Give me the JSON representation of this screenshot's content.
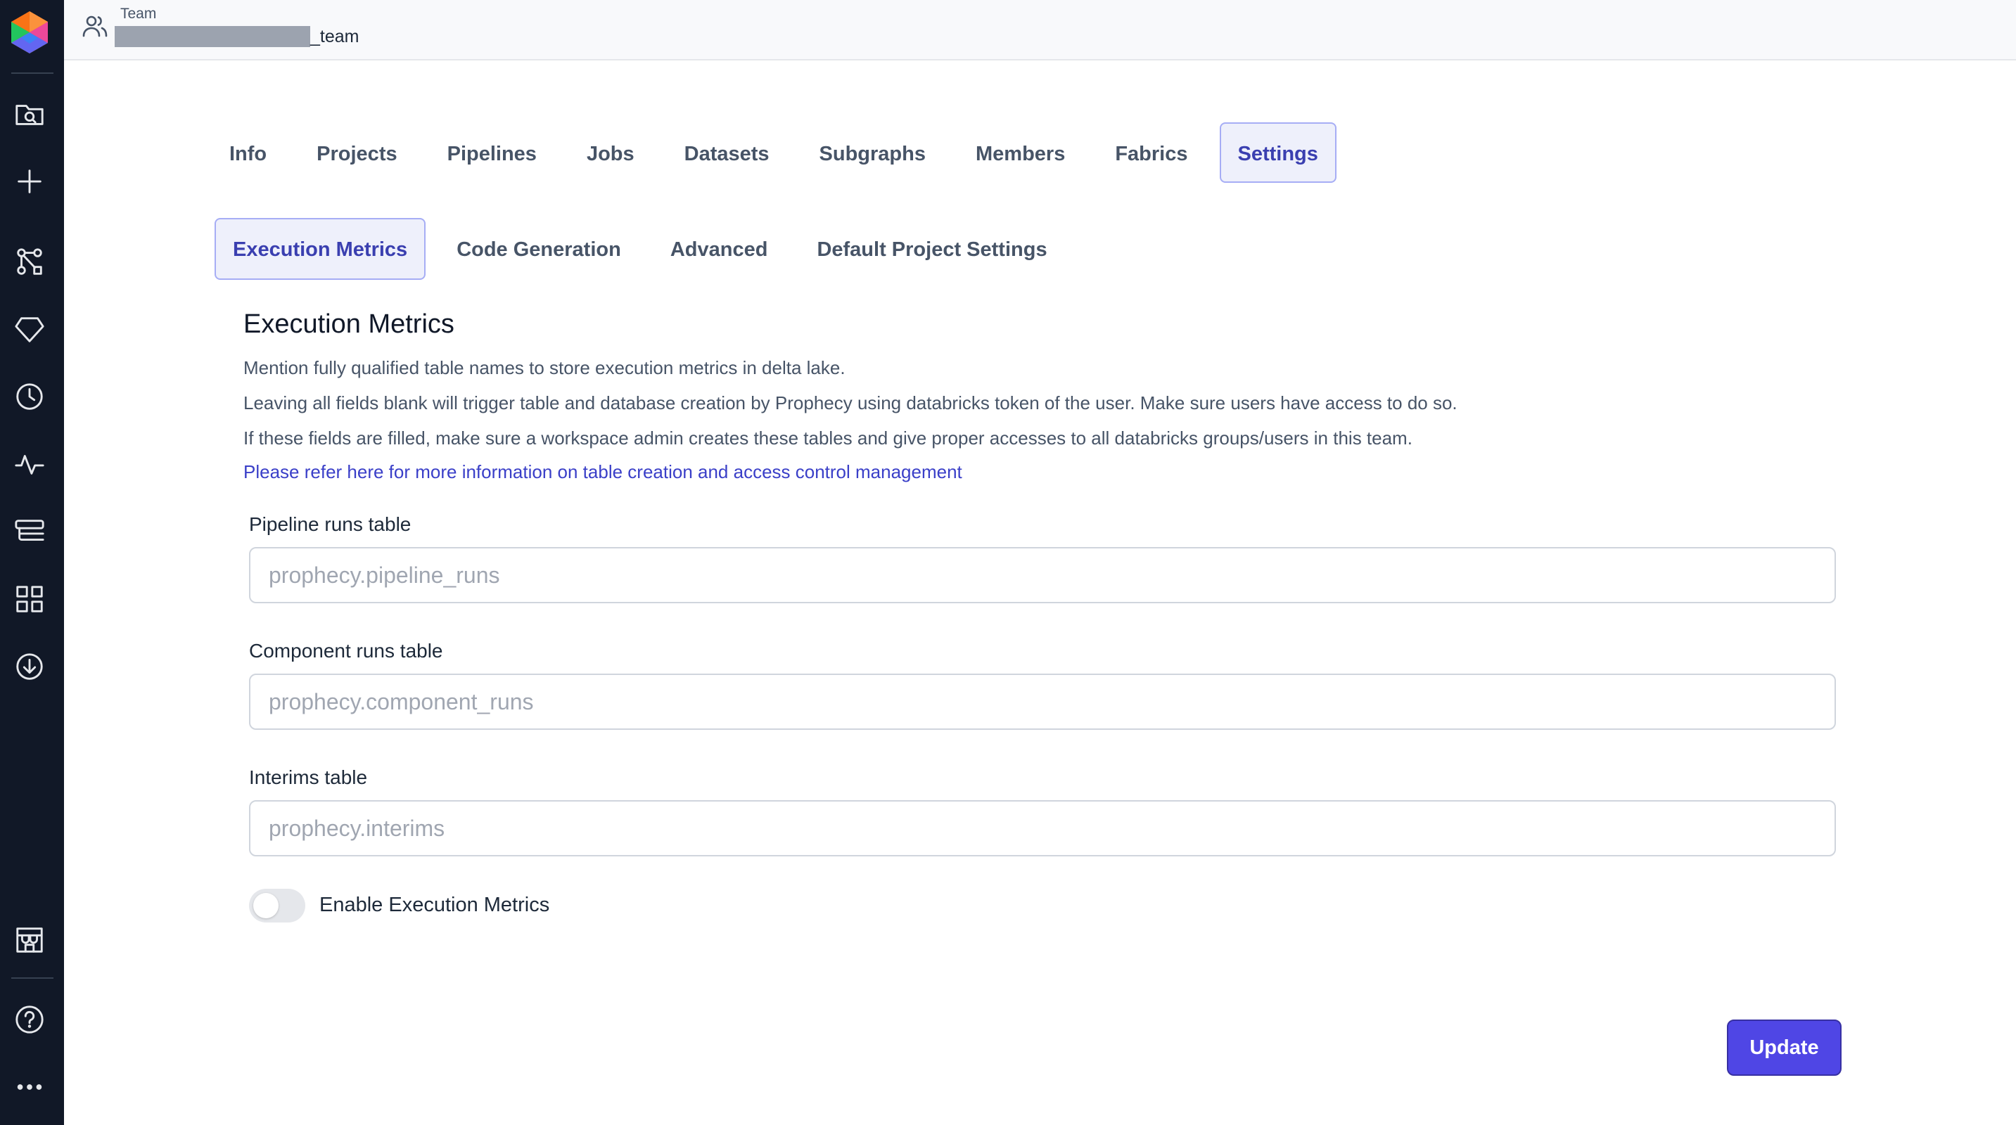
{
  "header": {
    "caption": "Team",
    "team_suffix": "_team"
  },
  "tabs": [
    {
      "label": "Info"
    },
    {
      "label": "Projects"
    },
    {
      "label": "Pipelines"
    },
    {
      "label": "Jobs"
    },
    {
      "label": "Datasets"
    },
    {
      "label": "Subgraphs"
    },
    {
      "label": "Members"
    },
    {
      "label": "Fabrics"
    },
    {
      "label": "Settings",
      "active": true
    }
  ],
  "subtabs": [
    {
      "label": "Execution Metrics",
      "active": true
    },
    {
      "label": "Code Generation"
    },
    {
      "label": "Advanced"
    },
    {
      "label": "Default Project Settings"
    }
  ],
  "section": {
    "title": "Execution Metrics",
    "lines": [
      "Mention fully qualified table names to store execution metrics in delta lake.",
      "Leaving all fields blank will trigger table and database creation by Prophecy using databricks token of the user. Make sure users have access to do so.",
      "If these fields are filled, make sure a workspace admin creates these tables and give proper accesses to all databricks groups/users in this team."
    ],
    "link": "Please refer here for more information on table creation and access control management"
  },
  "fields": [
    {
      "label": "Pipeline runs table",
      "value": "",
      "placeholder": "prophecy.pipeline_runs"
    },
    {
      "label": "Component runs table",
      "value": "",
      "placeholder": "prophecy.component_runs"
    },
    {
      "label": "Interims table",
      "value": "",
      "placeholder": "prophecy.interims"
    }
  ],
  "toggle": {
    "label": "Enable Execution Metrics",
    "enabled": false
  },
  "update_label": "Update",
  "sidebar_icons": [
    "folder-search-icon",
    "plus-icon",
    "graph-icon",
    "diamond-icon",
    "clock-icon",
    "activity-icon",
    "tables-icon",
    "grid-icon",
    "download-icon",
    "store-icon",
    "help-icon",
    "more-icon"
  ],
  "colors": {
    "sidebar": "#111827",
    "accent": "#4f46e5",
    "active_tab_bg": "#eef0fb",
    "active_tab_text": "#3a3fb0",
    "link": "#3a3fc8"
  }
}
